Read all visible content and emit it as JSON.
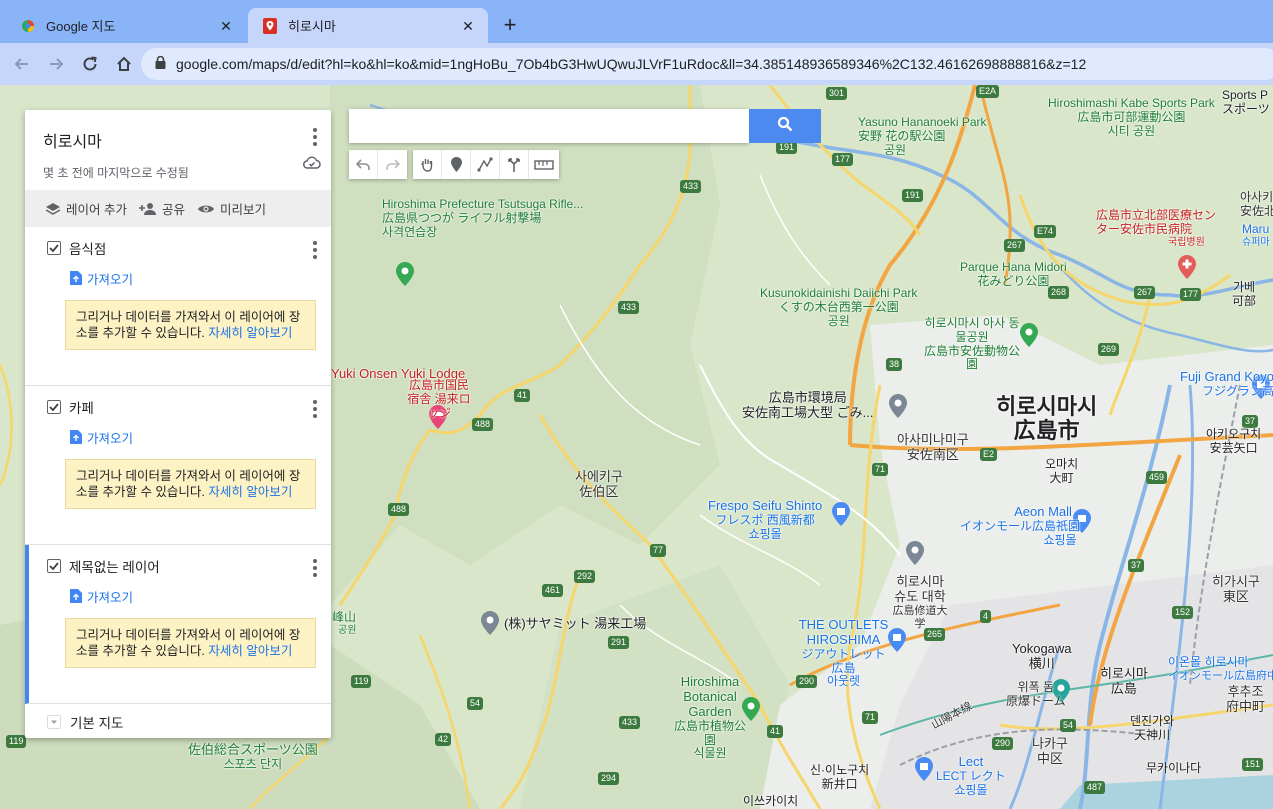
{
  "browser": {
    "tabs": [
      {
        "title": "Google 지도",
        "active": false
      },
      {
        "title": "히로시마",
        "active": true
      }
    ],
    "url": "google.com/maps/d/edit?hl=ko&hl=ko&mid=1ngHoBu_7Ob4bG3HwUQwuJLVrF1uRdoc&ll=34.38514893658934​6%2C132.46162698888816&z=12"
  },
  "panel": {
    "title": "히로시마",
    "subtitle": "몇 초 전에 마지막으로 수정됨",
    "actions": {
      "add_layer": "레이어 추가",
      "share": "공유",
      "preview": "미리보기"
    },
    "layers": [
      {
        "name": "음식점",
        "import": "가져오기",
        "note": "그리거나 데이터를 가져와서 이 레이어에 장소를 추가할 수 있습니다.",
        "note_link": "자세히 알아보기"
      },
      {
        "name": "카페",
        "import": "가져오기",
        "note": "그리거나 데이터를 가져와서 이 레이어에 장소를 추가할 수 있습니다.",
        "note_link": "자세히 알아보기"
      },
      {
        "name": "제목없는 레이어",
        "import": "가져오기",
        "note": "그리거나 데이터를 가져와서 이 레이어에 장소를 추가할 수 있습니다.",
        "note_link": "자세히 알아보기"
      }
    ],
    "basemap": "기본 지도"
  },
  "map": {
    "labels": {
      "city_ko": "히로시마시",
      "city_ja": "広島市",
      "hananoeki": "Yasuno Hananoeki Park",
      "hananoeki_ja": "安野 花の駅公園",
      "hananoeki_ko": "공원",
      "kabe": "Hiroshimashi Kabe Sports Park",
      "kabe_ja": "広島市可部運動公園",
      "kabe_ko": "시티 공원",
      "tsutsuga": "Hiroshima Prefecture Tsutsuga Rifle...",
      "tsutsuga_ja": "広島県つつが ライフル射撃場",
      "tsutsuga_ko": "사격연습장",
      "hospital_ja": "広島市立北部医療センター安佐市民病院",
      "hospital_ko": "국립병원",
      "hanamidori": "Parque Hana Midori",
      "hanamidori_ja": "花みどり公園",
      "kusunoki": "Kusunokidainishi Daiichi Park",
      "kusunoki_ja": "くすの木台西第一公園",
      "kusunoki_ko": "공원",
      "zoo_ko": "히로시마시 아사 동물공원",
      "zoo_ja": "広島市安佐動物公園",
      "yuki": "Yuki Onsen Yuki Lodge",
      "yuki_ja": "広島市国民 宿舎 湯来ロッジ",
      "kankyo": "広島市環境局",
      "kankyo2": "安佐南工場大型 ごみ...",
      "asaminami_ko": "아사미나미구",
      "asaminami_ja": "安佐南区",
      "saeki_ko": "사에키구",
      "saeki_ja": "佐伯区",
      "frespo": "Frespo Seifu Shinto",
      "frespo_ja": "フレスポ 西風新都",
      "frespo_ko": "쇼핑몰",
      "aeon": "Aeon Mall",
      "aeon_ja": "イオンモール広島祇園",
      "aeon_ko": "쇼핑몰",
      "fuji": "Fuji Grand Koyo",
      "fuji_ja": "フジグラン高陽",
      "shudo_ko": "히로시마 슈도 대학",
      "shudo_ja": "広島修道大学",
      "samit": "(株)サヤミット 湯来工場",
      "outlets": "THE OUTLETS HIROSHIMA",
      "outlets_ja": "ジアウトレット広島",
      "outlets_ko": "아웃렛",
      "botanical": "Hiroshima Botanical Garden",
      "botanical_ja": "広島市植物公園",
      "botanical_ko": "식물원",
      "yokogawa": "Yokogawa",
      "yokogawa_ja": "横川",
      "peace": "위폭 돔",
      "peace_ja": "原爆ドーム",
      "nakaku_ko": "나카구",
      "nakaku_ja": "中区",
      "higashi_ko": "히가시구",
      "higashi_ja": "東区",
      "hiroshima_st": "히로시마",
      "hiroshima_st_ja": "広島",
      "lect": "Lect",
      "lect_ja": "LECT レクト",
      "lect_ko": "쇼핑몰",
      "saeki_park": "佐伯総合スポーツ公園",
      "saeki_park_ko": "스포츠 단지",
      "kabe_st": "가베",
      "kabe_st_ja": "可部",
      "shinji": "신·이노구치",
      "shinji_ja": "新井口",
      "aki": "아키오구치",
      "aki_ja": "安芸矢口",
      "dentetsu": "덴진가와",
      "dentetsu_ja": "天神川",
      "oomachi": "오마치",
      "oomachi_ja": "大町",
      "sanyo": "山陽本線",
      "mukainada": "무카이나다",
      "fuchu": "후추조",
      "fuchu_ja": "府中町",
      "ion_hiroshima": "이온몰 히로시마",
      "ion_fuchu": "イオンモール広島府中",
      "itsukaichi": "이쓰카이치",
      "mihara": "峰山",
      "mihara_ko": "공원",
      "sports": "Sports P",
      "sports_ja": "スポーツ",
      "maru": "Maru",
      "maru_ja": "슈퍼마",
      "asakita": "아사키",
      "asakita_ja": "安佐北"
    },
    "roads": [
      "301",
      "177",
      "191",
      "191",
      "433",
      "433",
      "41",
      "488",
      "488",
      "267",
      "267",
      "177",
      "268",
      "269",
      "38",
      "71",
      "77",
      "292",
      "461",
      "54",
      "291",
      "265",
      "4",
      "152",
      "37",
      "37",
      "459",
      "290",
      "71",
      "41",
      "42",
      "433",
      "294",
      "119",
      "119",
      "54",
      "290",
      "487",
      "151",
      "E74",
      "E2",
      "E2A"
    ]
  }
}
